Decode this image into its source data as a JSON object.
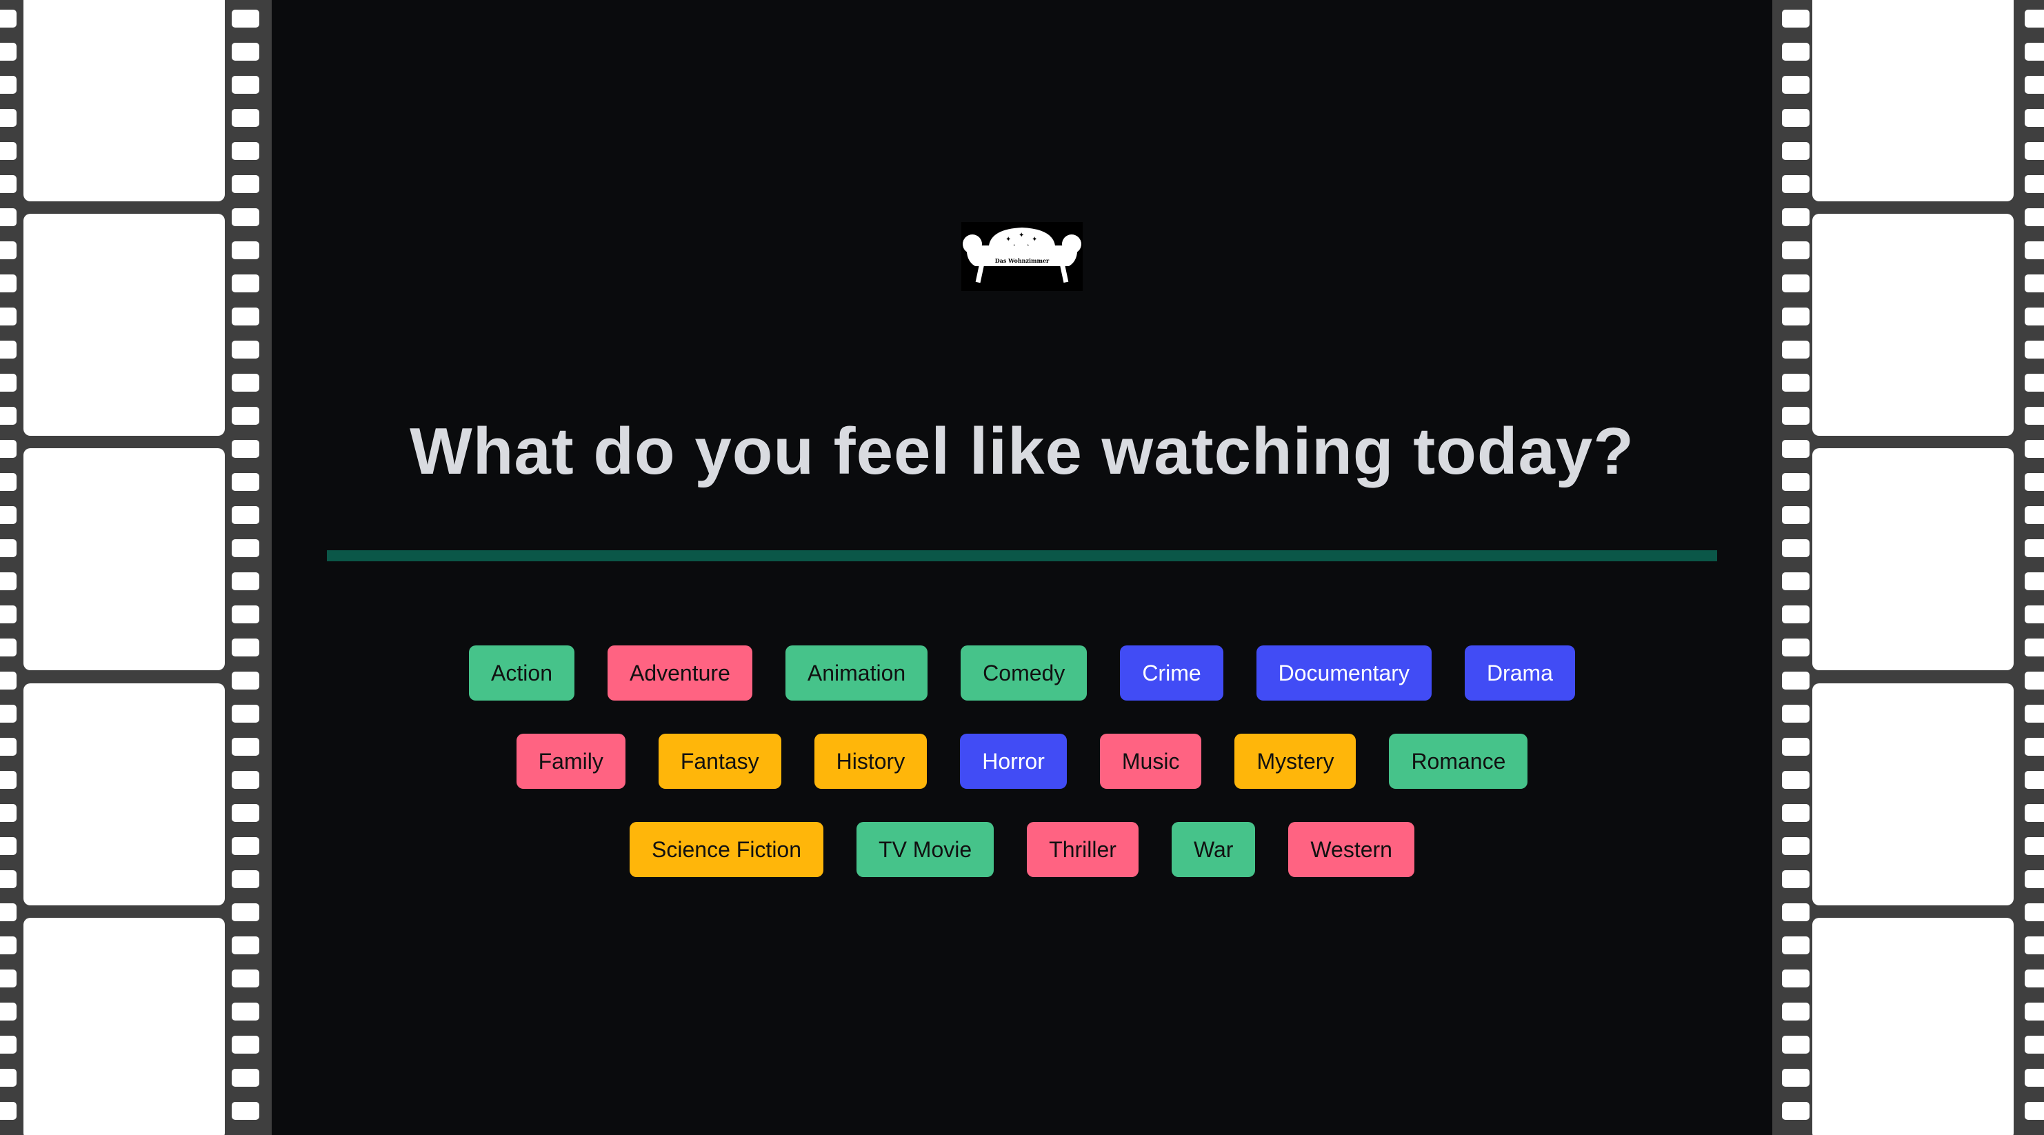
{
  "title": "What do you feel like watching today?",
  "logo": {
    "icon": "sofa-logo-icon",
    "text": "Das Wohnzimmer"
  },
  "colors": {
    "green": "#46c38a",
    "pink": "#ff6382",
    "yellow": "#ffb60a",
    "blue": "#414cf5",
    "divider": "#0b5748",
    "background": "#0a0b0d",
    "title": "#d9dbe0"
  },
  "genres": {
    "row1": [
      {
        "label": "Action",
        "color": "green"
      },
      {
        "label": "Adventure",
        "color": "pink"
      },
      {
        "label": "Animation",
        "color": "green"
      },
      {
        "label": "Comedy",
        "color": "green"
      },
      {
        "label": "Crime",
        "color": "blue"
      },
      {
        "label": "Documentary",
        "color": "blue"
      },
      {
        "label": "Drama",
        "color": "blue"
      }
    ],
    "row2": [
      {
        "label": "Family",
        "color": "pink"
      },
      {
        "label": "Fantasy",
        "color": "yellow"
      },
      {
        "label": "History",
        "color": "yellow"
      },
      {
        "label": "Horror",
        "color": "blue"
      },
      {
        "label": "Music",
        "color": "pink"
      },
      {
        "label": "Mystery",
        "color": "yellow"
      },
      {
        "label": "Romance",
        "color": "green"
      }
    ],
    "row3": [
      {
        "label": "Science Fiction",
        "color": "yellow"
      },
      {
        "label": "TV Movie",
        "color": "green"
      },
      {
        "label": "Thriller",
        "color": "pink"
      },
      {
        "label": "War",
        "color": "green"
      },
      {
        "label": "Western",
        "color": "pink"
      }
    ]
  }
}
